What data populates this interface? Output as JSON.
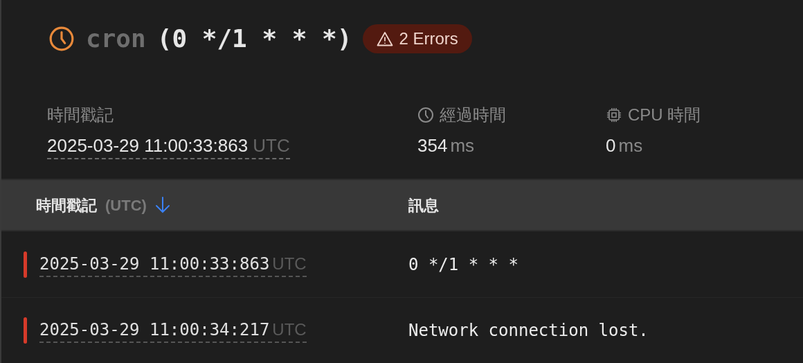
{
  "header": {
    "name": "cron",
    "schedule": "(0 */1 * * *)",
    "badge": "2 Errors"
  },
  "meta": [
    {
      "kind": "timestamp",
      "label": "時間戳記",
      "value": "2025-03-29 11:00:33:863",
      "unit": "UTC"
    },
    {
      "kind": "duration",
      "label": "經過時間",
      "value": "354",
      "unit": "ms"
    },
    {
      "kind": "cpu",
      "label": "CPU 時間",
      "value": "0",
      "unit": "ms"
    }
  ],
  "table": {
    "columns": [
      {
        "label": "時間戳記",
        "suffix": "(UTC)",
        "sorted_descending": true
      },
      {
        "label": "訊息"
      }
    ],
    "rows": [
      {
        "color": "#d63a2a",
        "timestamp": "2025-03-29 11:00:33:863",
        "unit": "UTC",
        "message": "0 */1 * * *"
      },
      {
        "color": "#d63a2a",
        "timestamp": "2025-03-29 11:00:34:217",
        "unit": "UTC",
        "message": "Network connection lost."
      }
    ]
  }
}
